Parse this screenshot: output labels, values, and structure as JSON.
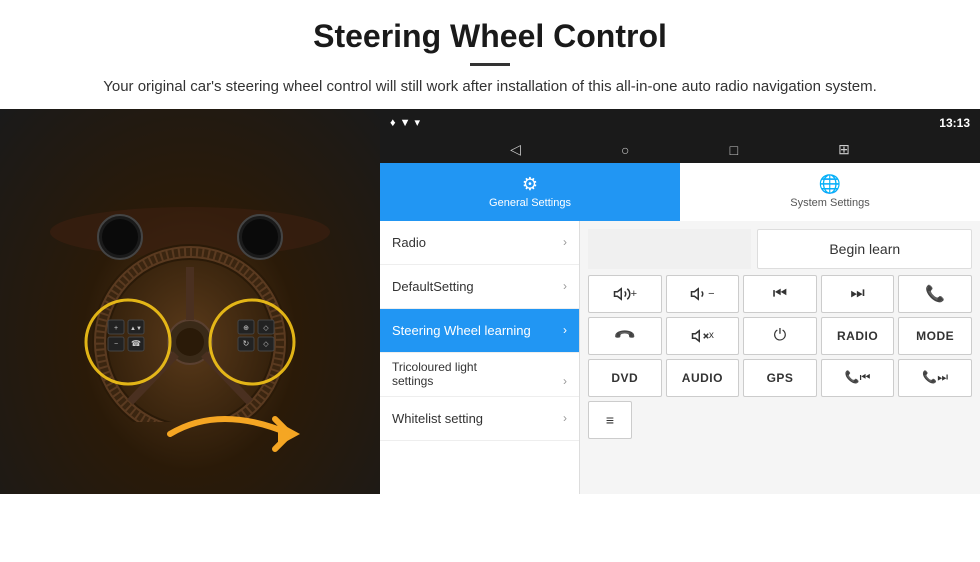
{
  "header": {
    "title": "Steering Wheel Control",
    "subtitle": "Your original car's steering wheel control will still work after installation of this all-in-one auto radio navigation system."
  },
  "status_bar": {
    "time": "13:13",
    "icons": [
      "▼",
      "♦",
      "📶"
    ]
  },
  "nav_bar": {
    "back_icon": "◁",
    "home_icon": "○",
    "recents_icon": "□",
    "screenshot_icon": "⊞"
  },
  "tabs": [
    {
      "id": "general",
      "label": "General Settings",
      "active": true
    },
    {
      "id": "system",
      "label": "System Settings",
      "active": false
    }
  ],
  "menu_items": [
    {
      "label": "Radio",
      "active": false
    },
    {
      "label": "DefaultSetting",
      "active": false
    },
    {
      "label": "Steering Wheel learning",
      "active": true
    },
    {
      "label": "Tricoloured light settings",
      "active": false
    },
    {
      "label": "Whitelist setting",
      "active": false
    }
  ],
  "controls": {
    "begin_learn_label": "Begin learn",
    "buttons_row1": [
      {
        "label": "🔊+",
        "type": "icon"
      },
      {
        "label": "🔊−",
        "type": "icon"
      },
      {
        "label": "⏮",
        "type": "icon"
      },
      {
        "label": "⏭",
        "type": "icon"
      },
      {
        "label": "📞",
        "type": "icon"
      }
    ],
    "buttons_row2": [
      {
        "label": "↩",
        "type": "icon"
      },
      {
        "label": "🔇",
        "type": "icon"
      },
      {
        "label": "⏻",
        "type": "icon"
      },
      {
        "label": "RADIO",
        "type": "text"
      },
      {
        "label": "MODE",
        "type": "text"
      }
    ],
    "buttons_row3": [
      {
        "label": "DVD",
        "type": "text"
      },
      {
        "label": "AUDIO",
        "type": "text"
      },
      {
        "label": "GPS",
        "type": "text"
      },
      {
        "label": "📞⏮",
        "type": "icon"
      },
      {
        "label": "📞⏭",
        "type": "icon"
      }
    ],
    "whitelist_icon": "≡"
  }
}
